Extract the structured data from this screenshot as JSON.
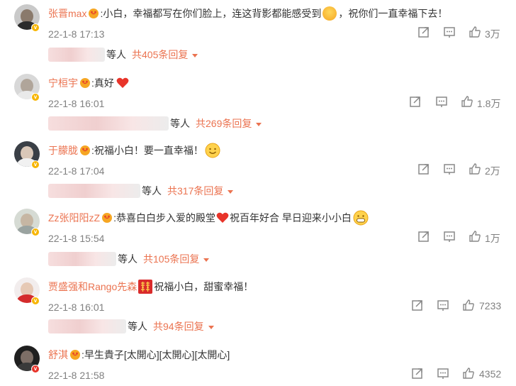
{
  "colors": {
    "accent": "#eb7350",
    "meta": "#808080",
    "badge": "#f7b500"
  },
  "comments": [
    {
      "user": "张晋max",
      "text": ":小白，幸福都写在你们脸上，连这背影都能感受到",
      "text2": "，祝你们一直幸福下去！",
      "emoji": "laughing-emoji",
      "time": "22-1-8 17:13",
      "likes": "3万",
      "replies": {
        "prefix": "等人",
        "count": "共405条回复"
      }
    },
    {
      "user": "宁桓宇",
      "text": ":真好",
      "emoji": "red-heart-emoji",
      "time": "22-1-8 16:01",
      "likes": "1.8万",
      "replies": {
        "prefix": "等人",
        "count": "共269条回复"
      }
    },
    {
      "user": "于朦胧",
      "text": ":祝福小白！要一直幸福！",
      "emoji": "smile-emoji",
      "time": "22-1-8 17:04",
      "likes": "2万",
      "replies": {
        "prefix": "等人",
        "count": "共317条回复"
      }
    },
    {
      "user": "Zz张阳阳zZ",
      "text": ":恭喜白白步入爱的殿堂",
      "text2": " 祝百年好合 早日迎来小小白",
      "emoji": "red-heart-emoji",
      "emoji2": "grin-emoji",
      "time": "22-1-8 15:54",
      "likes": "1万",
      "replies": {
        "prefix": "等人",
        "count": "共105条回复"
      }
    },
    {
      "user": "贾盛强和Rango先森",
      "text": "祝福小白，甜蜜幸福！",
      "emoji": "double-happiness-emoji",
      "time": "22-1-8 16:01",
      "likes": "7233",
      "replies": {
        "prefix": "等人",
        "count": "共94条回复"
      }
    },
    {
      "user": "舒淇",
      "text": ":早生貴子[太開心][太開心][太開心]",
      "time": "22-1-8 21:58",
      "likes": "4352"
    }
  ]
}
